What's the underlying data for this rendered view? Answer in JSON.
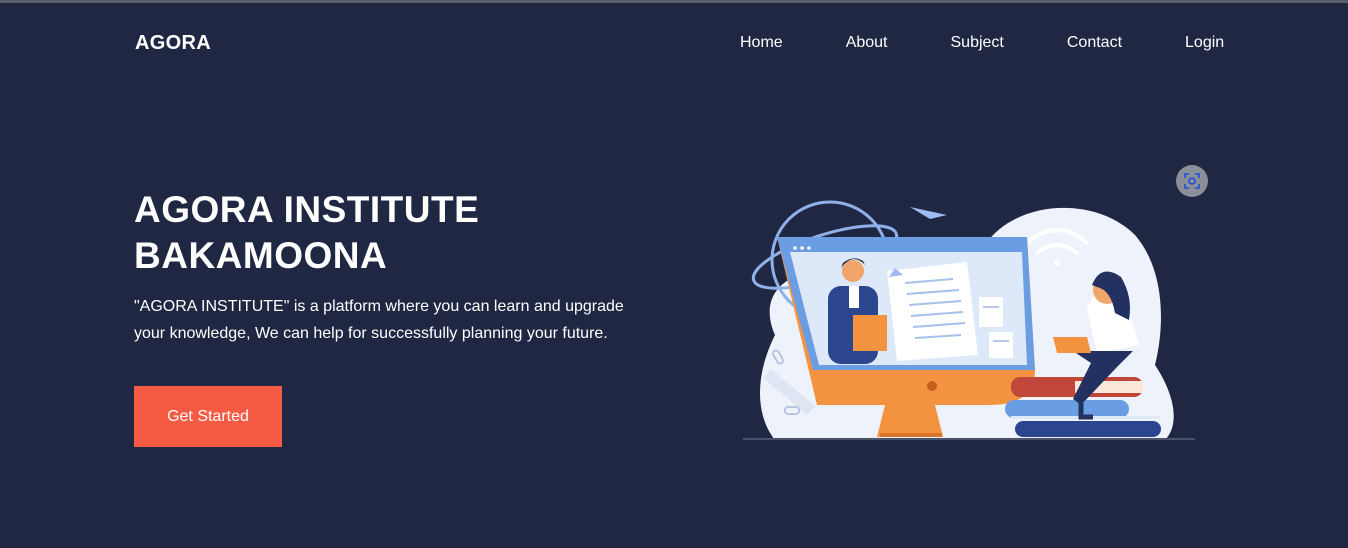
{
  "header": {
    "brand": "AGORA",
    "nav": [
      "Home",
      "About",
      "Subject",
      "Contact",
      "Login"
    ]
  },
  "hero": {
    "title_line1": "AGORA INSTITUTE",
    "title_line2": "BAKAMOONA",
    "description": "\"AGORA INSTITUTE\" is a platform where you can learn and upgrade your knowledge, We can help for successfully planning your future.",
    "cta_label": "Get Started"
  },
  "icons": {
    "image_overlay": "visual-search-icon",
    "illustration": "online-education-illustration"
  },
  "colors": {
    "background": "#1f2743",
    "accent": "#f55a42",
    "text": "#ffffff"
  }
}
